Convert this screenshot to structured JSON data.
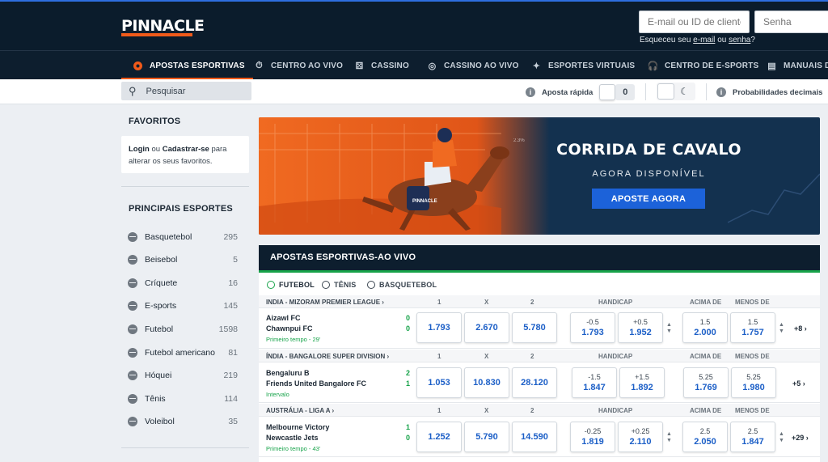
{
  "header": {
    "logo": "PINNACLE",
    "email_placeholder": "E-mail ou ID de cliente",
    "password_placeholder": "Senha",
    "forgot_prefix": "Esqueceu seu",
    "forgot_email": "e-mail",
    "forgot_or": "ou",
    "forgot_password": "senha",
    "forgot_suffix": "?"
  },
  "nav": [
    {
      "label": "APOSTAS ESPORTIVAS",
      "icon": "soccer-ball-icon",
      "active": true
    },
    {
      "label": "CENTRO AO VIVO",
      "icon": "stopwatch-icon"
    },
    {
      "label": "CASSINO",
      "icon": "dice-icon"
    },
    {
      "label": "CASSINO AO VIVO",
      "icon": "chip-icon"
    },
    {
      "label": "ESPORTES VIRTUAIS",
      "icon": "virtual-sports-icon"
    },
    {
      "label": "CENTRO DE E-SPORTS",
      "icon": "headset-icon"
    },
    {
      "label": "MANUAIS DE",
      "icon": "book-icon"
    }
  ],
  "subbar": {
    "search_placeholder": "Pesquisar",
    "quick_bet_label": "Aposta rápida",
    "quick_bet_count": "0",
    "odds_format": "Probabilidades decimais"
  },
  "sidebar": {
    "favorites_title": "FAVORITOS",
    "fav_login": "Login",
    "fav_or": "ou",
    "fav_register": "Cadastrar-se",
    "fav_text1": "para",
    "fav_text2": "alterar os seus favoritos.",
    "sports_title": "PRINCIPAIS ESPORTES",
    "sports": [
      {
        "name": "Basquetebol",
        "count": "295"
      },
      {
        "name": "Beisebol",
        "count": "5"
      },
      {
        "name": "Críquete",
        "count": "16"
      },
      {
        "name": "E-sports",
        "count": "145"
      },
      {
        "name": "Futebol",
        "count": "1598"
      },
      {
        "name": "Futebol americano",
        "count": "81"
      },
      {
        "name": "Hóquei",
        "count": "219"
      },
      {
        "name": "Tênis",
        "count": "114"
      },
      {
        "name": "Voleibol",
        "count": "35"
      }
    ]
  },
  "banner": {
    "title": "CORRIDA DE CAVALO",
    "subtitle": "AGORA DISPONÍVEL",
    "cta": "APOSTE AGORA",
    "art_label": "PINNACLE",
    "art_rate": "2.3%"
  },
  "live": {
    "title": "APOSTAS ESPORTIVAS-AO VIVO",
    "tabs": [
      "FUTEBOL",
      "TÊNIS",
      "BASQUETEBOL"
    ],
    "col_headers": {
      "one": "1",
      "x": "X",
      "two": "2",
      "handicap": "HANDICAP",
      "over": "ACIMA DE",
      "under": "MENOS DE"
    },
    "leagues": [
      {
        "name": "INDIA - MIZORAM PREMIER LEAGUE",
        "home": "Aizawl FC",
        "away": "Chawnpui FC",
        "home_score": "0",
        "away_score": "0",
        "status": "Primeiro tempo - 29'",
        "odds": [
          "1.793",
          "2.670",
          "5.780"
        ],
        "hcap": [
          {
            "line": "-0.5",
            "odd": "1.793"
          },
          {
            "line": "+0.5",
            "odd": "1.952"
          }
        ],
        "totals": [
          {
            "line": "1.5",
            "odd": "2.000"
          },
          {
            "line": "1.5",
            "odd": "1.757"
          }
        ],
        "more": "+8"
      },
      {
        "name": "ÍNDIA - BANGALORE SUPER DIVISION",
        "home": "Bengaluru B",
        "away": "Friends United Bangalore FC",
        "home_score": "2",
        "away_score": "1",
        "status": "Intervalo",
        "odds": [
          "1.053",
          "10.830",
          "28.120"
        ],
        "hcap": [
          {
            "line": "-1.5",
            "odd": "1.847"
          },
          {
            "line": "+1.5",
            "odd": "1.892"
          }
        ],
        "totals": [
          {
            "line": "5.25",
            "odd": "1.769"
          },
          {
            "line": "5.25",
            "odd": "1.980"
          }
        ],
        "more": "+5"
      },
      {
        "name": "AUSTRÁLIA - LIGA A",
        "home": "Melbourne Victory",
        "away": "Newcastle Jets",
        "home_score": "1",
        "away_score": "0",
        "status": "Primeiro tempo - 43'",
        "odds": [
          "1.252",
          "5.790",
          "14.590"
        ],
        "hcap": [
          {
            "line": "-0.25",
            "odd": "1.819"
          },
          {
            "line": "+0.25",
            "odd": "2.110"
          }
        ],
        "totals": [
          {
            "line": "2.5",
            "odd": "2.050"
          },
          {
            "line": "2.5",
            "odd": "1.847"
          }
        ],
        "more": "+29"
      }
    ]
  },
  "colors": {
    "brand_orange": "#f05a1a",
    "header_navy": "#0b1c2c",
    "accent_blue": "#1c62d9",
    "live_green": "#17a34a"
  }
}
